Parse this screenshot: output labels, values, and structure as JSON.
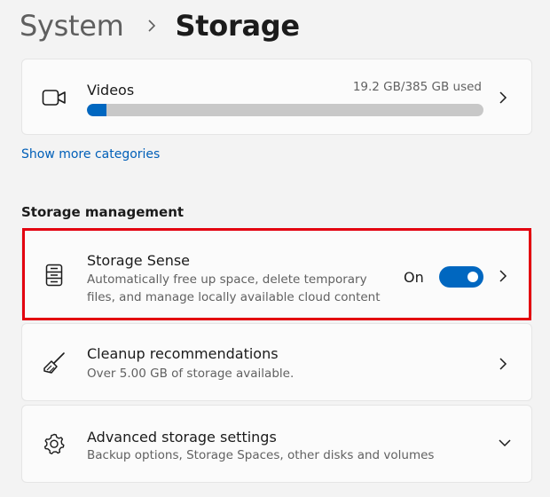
{
  "breadcrumb": {
    "parent": "System",
    "current": "Storage"
  },
  "videos": {
    "title": "Videos",
    "usage_text": "19.2 GB/385 GB used",
    "used_gb": 19.2,
    "total_gb": 385,
    "icon": "video-camera-icon"
  },
  "show_more_label": "Show more categories",
  "storage_management": {
    "heading": "Storage management",
    "storage_sense": {
      "title": "Storage Sense",
      "desc_line1": "Automatically free up space, delete temporary",
      "desc_line2": "files, and manage locally available cloud content",
      "toggle_label": "On",
      "toggle_on": true,
      "icon": "storage-sense-icon"
    },
    "cleanup": {
      "title": "Cleanup recommendations",
      "desc": "Over 5.00 GB of storage available.",
      "icon": "broom-icon"
    },
    "advanced": {
      "title": "Advanced storage settings",
      "desc": "Backup options, Storage Spaces, other disks and volumes",
      "icon": "gear-icon"
    }
  },
  "colors": {
    "accent": "#0067c0",
    "highlight": "#e3000f",
    "link": "#005fb8"
  }
}
